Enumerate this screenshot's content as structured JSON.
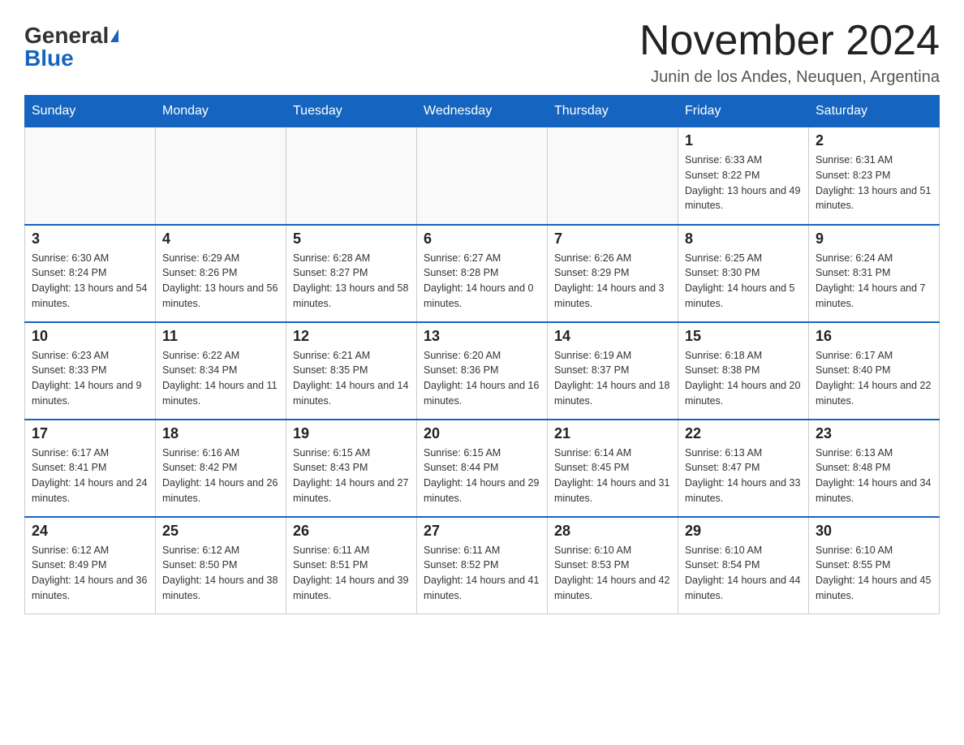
{
  "header": {
    "logo_general": "General",
    "logo_blue": "Blue",
    "title": "November 2024",
    "subtitle": "Junin de los Andes, Neuquen, Argentina"
  },
  "days_of_week": [
    "Sunday",
    "Monday",
    "Tuesday",
    "Wednesday",
    "Thursday",
    "Friday",
    "Saturday"
  ],
  "weeks": [
    [
      {
        "day": "",
        "sunrise": "",
        "sunset": "",
        "daylight": ""
      },
      {
        "day": "",
        "sunrise": "",
        "sunset": "",
        "daylight": ""
      },
      {
        "day": "",
        "sunrise": "",
        "sunset": "",
        "daylight": ""
      },
      {
        "day": "",
        "sunrise": "",
        "sunset": "",
        "daylight": ""
      },
      {
        "day": "",
        "sunrise": "",
        "sunset": "",
        "daylight": ""
      },
      {
        "day": "1",
        "sunrise": "Sunrise: 6:33 AM",
        "sunset": "Sunset: 8:22 PM",
        "daylight": "Daylight: 13 hours and 49 minutes."
      },
      {
        "day": "2",
        "sunrise": "Sunrise: 6:31 AM",
        "sunset": "Sunset: 8:23 PM",
        "daylight": "Daylight: 13 hours and 51 minutes."
      }
    ],
    [
      {
        "day": "3",
        "sunrise": "Sunrise: 6:30 AM",
        "sunset": "Sunset: 8:24 PM",
        "daylight": "Daylight: 13 hours and 54 minutes."
      },
      {
        "day": "4",
        "sunrise": "Sunrise: 6:29 AM",
        "sunset": "Sunset: 8:26 PM",
        "daylight": "Daylight: 13 hours and 56 minutes."
      },
      {
        "day": "5",
        "sunrise": "Sunrise: 6:28 AM",
        "sunset": "Sunset: 8:27 PM",
        "daylight": "Daylight: 13 hours and 58 minutes."
      },
      {
        "day": "6",
        "sunrise": "Sunrise: 6:27 AM",
        "sunset": "Sunset: 8:28 PM",
        "daylight": "Daylight: 14 hours and 0 minutes."
      },
      {
        "day": "7",
        "sunrise": "Sunrise: 6:26 AM",
        "sunset": "Sunset: 8:29 PM",
        "daylight": "Daylight: 14 hours and 3 minutes."
      },
      {
        "day": "8",
        "sunrise": "Sunrise: 6:25 AM",
        "sunset": "Sunset: 8:30 PM",
        "daylight": "Daylight: 14 hours and 5 minutes."
      },
      {
        "day": "9",
        "sunrise": "Sunrise: 6:24 AM",
        "sunset": "Sunset: 8:31 PM",
        "daylight": "Daylight: 14 hours and 7 minutes."
      }
    ],
    [
      {
        "day": "10",
        "sunrise": "Sunrise: 6:23 AM",
        "sunset": "Sunset: 8:33 PM",
        "daylight": "Daylight: 14 hours and 9 minutes."
      },
      {
        "day": "11",
        "sunrise": "Sunrise: 6:22 AM",
        "sunset": "Sunset: 8:34 PM",
        "daylight": "Daylight: 14 hours and 11 minutes."
      },
      {
        "day": "12",
        "sunrise": "Sunrise: 6:21 AM",
        "sunset": "Sunset: 8:35 PM",
        "daylight": "Daylight: 14 hours and 14 minutes."
      },
      {
        "day": "13",
        "sunrise": "Sunrise: 6:20 AM",
        "sunset": "Sunset: 8:36 PM",
        "daylight": "Daylight: 14 hours and 16 minutes."
      },
      {
        "day": "14",
        "sunrise": "Sunrise: 6:19 AM",
        "sunset": "Sunset: 8:37 PM",
        "daylight": "Daylight: 14 hours and 18 minutes."
      },
      {
        "day": "15",
        "sunrise": "Sunrise: 6:18 AM",
        "sunset": "Sunset: 8:38 PM",
        "daylight": "Daylight: 14 hours and 20 minutes."
      },
      {
        "day": "16",
        "sunrise": "Sunrise: 6:17 AM",
        "sunset": "Sunset: 8:40 PM",
        "daylight": "Daylight: 14 hours and 22 minutes."
      }
    ],
    [
      {
        "day": "17",
        "sunrise": "Sunrise: 6:17 AM",
        "sunset": "Sunset: 8:41 PM",
        "daylight": "Daylight: 14 hours and 24 minutes."
      },
      {
        "day": "18",
        "sunrise": "Sunrise: 6:16 AM",
        "sunset": "Sunset: 8:42 PM",
        "daylight": "Daylight: 14 hours and 26 minutes."
      },
      {
        "day": "19",
        "sunrise": "Sunrise: 6:15 AM",
        "sunset": "Sunset: 8:43 PM",
        "daylight": "Daylight: 14 hours and 27 minutes."
      },
      {
        "day": "20",
        "sunrise": "Sunrise: 6:15 AM",
        "sunset": "Sunset: 8:44 PM",
        "daylight": "Daylight: 14 hours and 29 minutes."
      },
      {
        "day": "21",
        "sunrise": "Sunrise: 6:14 AM",
        "sunset": "Sunset: 8:45 PM",
        "daylight": "Daylight: 14 hours and 31 minutes."
      },
      {
        "day": "22",
        "sunrise": "Sunrise: 6:13 AM",
        "sunset": "Sunset: 8:47 PM",
        "daylight": "Daylight: 14 hours and 33 minutes."
      },
      {
        "day": "23",
        "sunrise": "Sunrise: 6:13 AM",
        "sunset": "Sunset: 8:48 PM",
        "daylight": "Daylight: 14 hours and 34 minutes."
      }
    ],
    [
      {
        "day": "24",
        "sunrise": "Sunrise: 6:12 AM",
        "sunset": "Sunset: 8:49 PM",
        "daylight": "Daylight: 14 hours and 36 minutes."
      },
      {
        "day": "25",
        "sunrise": "Sunrise: 6:12 AM",
        "sunset": "Sunset: 8:50 PM",
        "daylight": "Daylight: 14 hours and 38 minutes."
      },
      {
        "day": "26",
        "sunrise": "Sunrise: 6:11 AM",
        "sunset": "Sunset: 8:51 PM",
        "daylight": "Daylight: 14 hours and 39 minutes."
      },
      {
        "day": "27",
        "sunrise": "Sunrise: 6:11 AM",
        "sunset": "Sunset: 8:52 PM",
        "daylight": "Daylight: 14 hours and 41 minutes."
      },
      {
        "day": "28",
        "sunrise": "Sunrise: 6:10 AM",
        "sunset": "Sunset: 8:53 PM",
        "daylight": "Daylight: 14 hours and 42 minutes."
      },
      {
        "day": "29",
        "sunrise": "Sunrise: 6:10 AM",
        "sunset": "Sunset: 8:54 PM",
        "daylight": "Daylight: 14 hours and 44 minutes."
      },
      {
        "day": "30",
        "sunrise": "Sunrise: 6:10 AM",
        "sunset": "Sunset: 8:55 PM",
        "daylight": "Daylight: 14 hours and 45 minutes."
      }
    ]
  ]
}
